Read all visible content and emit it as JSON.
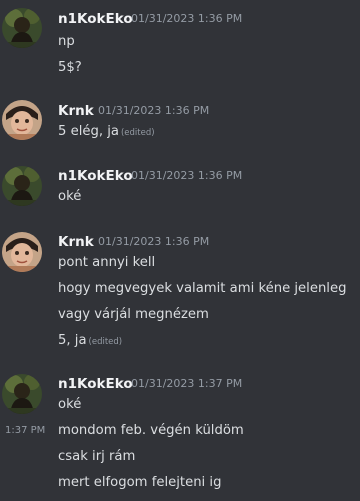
{
  "messages": [
    {
      "author": "n1KokEko",
      "timestamp": "01/31/2023 1:36 PM",
      "lines": [
        {
          "text": "np",
          "edited": ""
        },
        {
          "text": "5$?",
          "edited": ""
        }
      ]
    },
    {
      "author": "Krnk",
      "timestamp": "01/31/2023 1:36 PM",
      "lines": [
        {
          "text": "5 elég, ja",
          "edited": "(edited)"
        }
      ]
    },
    {
      "author": "n1KokEko",
      "timestamp": "01/31/2023 1:36 PM",
      "lines": [
        {
          "text": "oké",
          "edited": ""
        }
      ]
    },
    {
      "author": "Krnk",
      "timestamp": "01/31/2023 1:36 PM",
      "lines": [
        {
          "text": "pont annyi kell",
          "edited": ""
        },
        {
          "text": "hogy megvegyek valamit ami kéne jelenleg",
          "edited": ""
        },
        {
          "text": "vagy várjál megnézem",
          "edited": ""
        },
        {
          "text": "5, ja",
          "edited": "(edited)"
        }
      ]
    },
    {
      "author": "n1KokEko",
      "timestamp": "01/31/2023 1:37 PM",
      "hover_time": "1:37 PM",
      "lines": [
        {
          "text": "oké",
          "edited": ""
        },
        {
          "text": "mondom feb. végén küldöm",
          "edited": ""
        },
        {
          "text": "csak irj rám",
          "edited": ""
        },
        {
          "text": "mert elfogom felejteni ig",
          "edited": ""
        }
      ]
    }
  ],
  "colors": {
    "background": "#313338",
    "username": "#f2f3f5",
    "text": "#dbdee1",
    "muted": "#949ba4"
  }
}
